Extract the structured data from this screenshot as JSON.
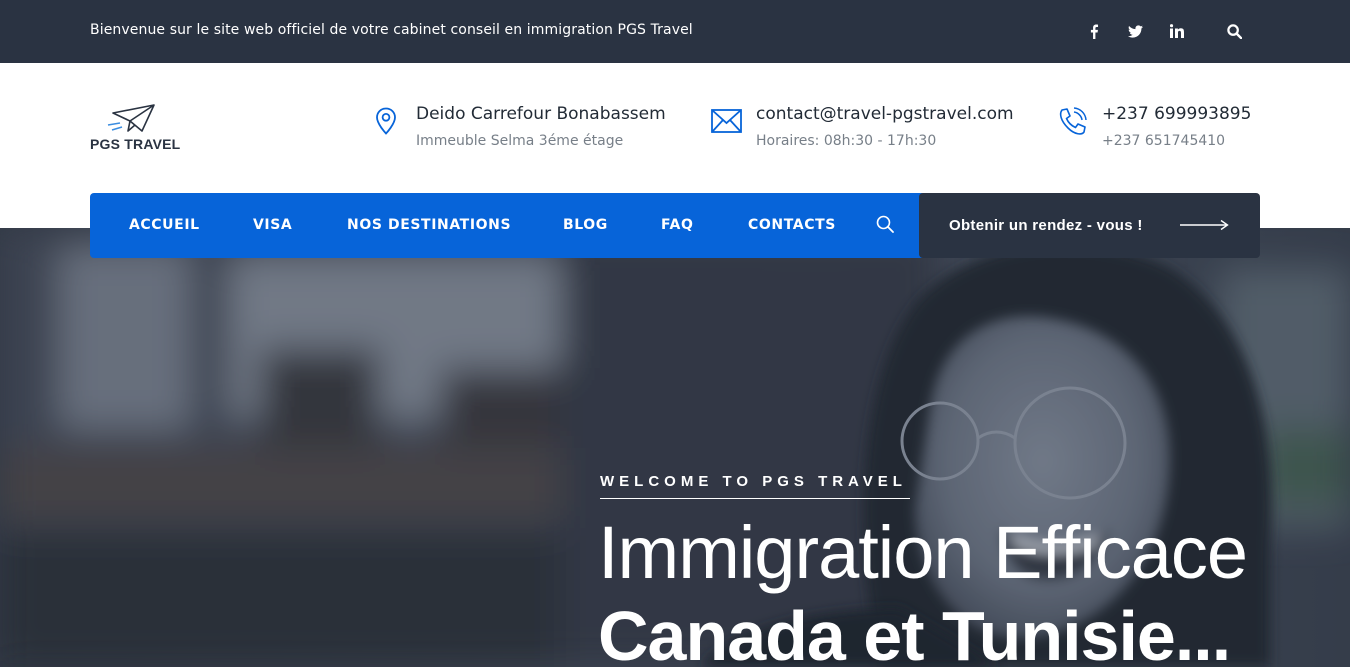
{
  "topbar": {
    "welcome": "Bienvenue sur le site web officiel de votre cabinet conseil en immigration PGS Travel",
    "social": [
      "facebook-icon",
      "twitter-icon",
      "linkedin-icon"
    ],
    "search_icon": "search-icon"
  },
  "brand": {
    "name": "PGS TRAVEL",
    "logo_icon": "paper-plane-icon"
  },
  "contact": {
    "address": {
      "main": "Deido Carrefour Bonabassem",
      "sub": "Immeuble Selma 3éme étage",
      "icon": "map-pin-icon"
    },
    "email": {
      "main": "contact@travel-pgstravel.com",
      "sub": "Horaires: 08h:30 - 17h:30",
      "icon": "envelope-icon"
    },
    "phone": {
      "main": "+237 699993895",
      "sub": "+237 651745410",
      "icon": "phone-icon"
    }
  },
  "nav": {
    "items": [
      "ACCUEIL",
      "VISA",
      "NOS DESTINATIONS",
      "BLOG",
      "FAQ",
      "CONTACTS"
    ],
    "search_icon": "search-icon",
    "cta": "Obtenir un rendez - vous !"
  },
  "hero": {
    "tagline": "WELCOME TO PGS TRAVEL",
    "headline_line1": "Immigration Efficace",
    "headline_line2": "Canada et Tunisie..."
  },
  "colors": {
    "topbar": "#2a3342",
    "nav": "#0764d9",
    "cta": "#2a3342",
    "accent_icon": "#0764d9"
  }
}
